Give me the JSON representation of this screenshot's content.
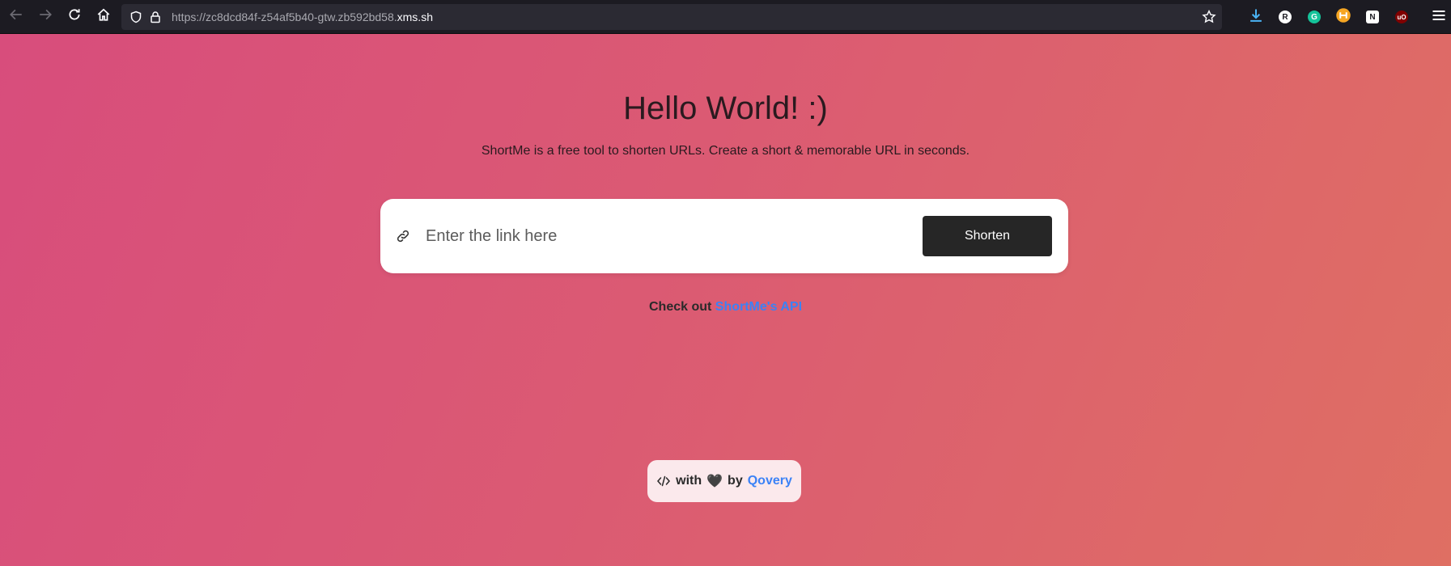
{
  "browser": {
    "url_prefix": "https://zc8dcd84f-z54af5b40-gtw.zb592bd58.",
    "url_host": "xms.sh",
    "extensions": [
      {
        "label": "R",
        "bg": "#ffffff",
        "fg": "#1c1b22"
      },
      {
        "label": "G",
        "bg": "#15c39a",
        "fg": "#ffffff"
      },
      {
        "label": "N",
        "bg": "#ffffff",
        "fg": "#1c1b22"
      },
      {
        "label": "uO",
        "bg": "#800000",
        "fg": "#ffffff"
      }
    ]
  },
  "hero": {
    "title": "Hello World! :)",
    "subtitle": "ShortMe is a free tool to shorten URLs. Create a short & memorable URL in seconds."
  },
  "form": {
    "input_placeholder": "Enter the link here",
    "input_value": "",
    "submit_label": "Shorten"
  },
  "api_note": {
    "prefix": "Check out",
    "link_text": "ShortMe's API"
  },
  "footer": {
    "with": "with",
    "heart": "🖤",
    "by": "by",
    "brand": "Qovery"
  },
  "colors": {
    "accent": "#3b82f6",
    "button_bg": "#262626"
  }
}
